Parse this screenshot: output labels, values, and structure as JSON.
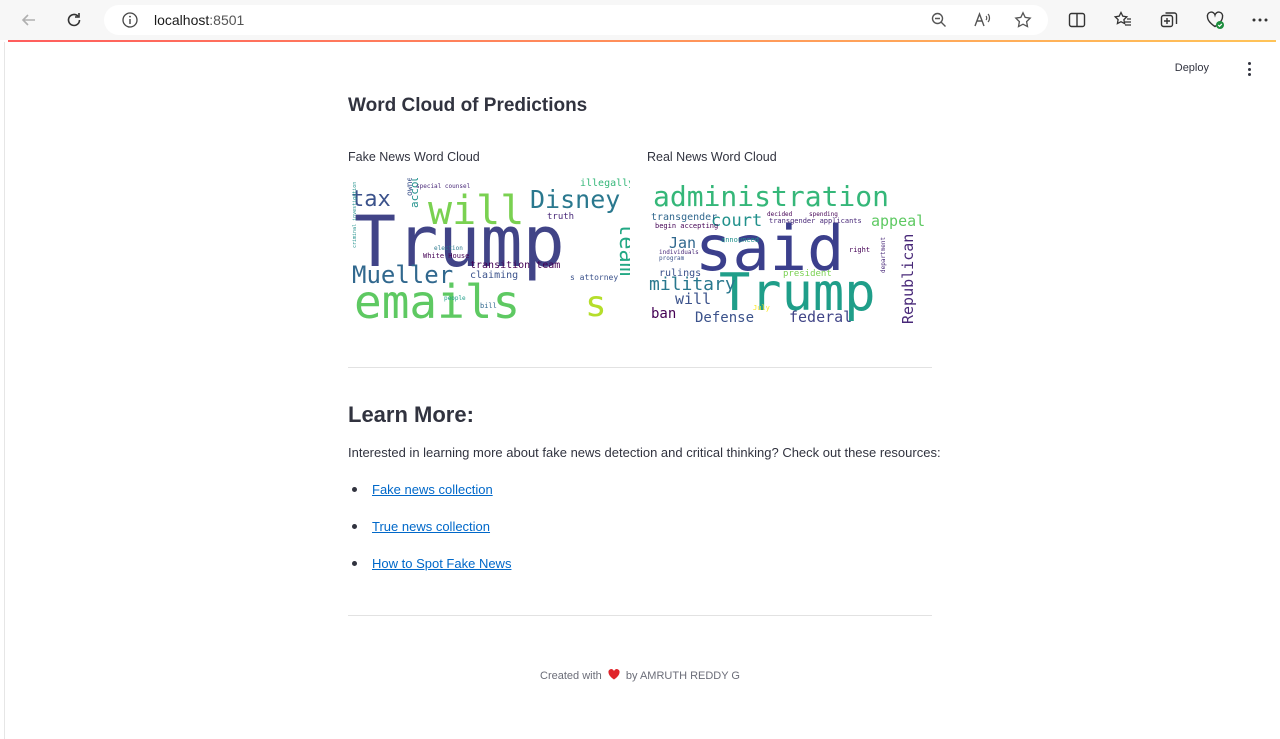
{
  "browser": {
    "url_host": "localhost",
    "url_port": ":8501"
  },
  "header": {
    "deploy_label": "Deploy"
  },
  "wordcloud_section": {
    "title": "Word Cloud of Predictions",
    "fake": {
      "caption": "Fake News Word Cloud",
      "words": [
        "Trump",
        "emails",
        "will",
        "Disney",
        "tax",
        "Mueller",
        "team",
        "transition team",
        "claiming",
        "White House",
        "account",
        "owner",
        "special counsel",
        "illegally",
        "truth",
        "people",
        "bill",
        "criminal investigation",
        "s attorney",
        "election"
      ]
    },
    "real": {
      "caption": "Real News Word Cloud",
      "words": [
        "said",
        "Trump",
        "administration",
        "court",
        "appeal",
        "military",
        "Republican",
        "Jan",
        "transgender",
        "Defense",
        "federal",
        "ban",
        "will",
        "president",
        "rulings",
        "spending",
        "transgender applicants",
        "begin accepting",
        "individuals",
        "program",
        "decided",
        "announced",
        "department",
        "right",
        "July"
      ]
    }
  },
  "learn_more": {
    "title": "Learn More:",
    "text": "Interested in learning more about fake news detection and critical thinking? Check out these resources:",
    "links": [
      {
        "label": "Fake news collection"
      },
      {
        "label": "True news collection"
      },
      {
        "label": "How to Spot Fake News"
      }
    ]
  },
  "footer": {
    "before": "Created with",
    "after": "by AMRUTH REDDY G"
  },
  "colors": {
    "link": "#0068c9",
    "text": "#31333f",
    "wc_dark": "#3b3f8c",
    "wc_mid": "#2a8a8a",
    "wc_green": "#5ec962",
    "wc_lime": "#b5de2b"
  }
}
